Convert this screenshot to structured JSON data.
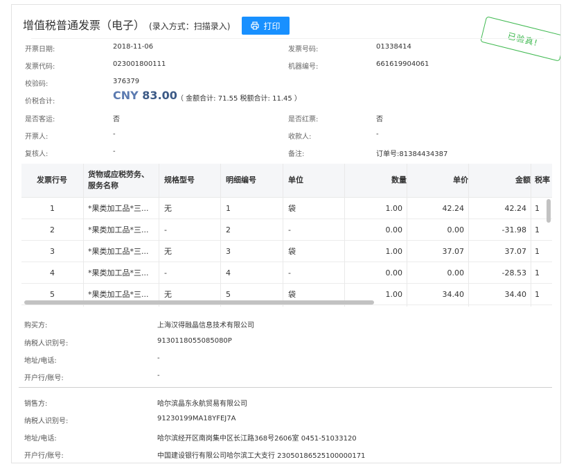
{
  "header": {
    "title": "增值税普通发票（电子）",
    "subtitle": "(录入方式：扫描录入)",
    "print_label": "打印",
    "stamp": "已验真!"
  },
  "info": {
    "issue_date_label": "开票日期:",
    "issue_date": "2018-11-06",
    "invoice_no_label": "发票号码:",
    "invoice_no": "01338414",
    "invoice_code_label": "发票代码:",
    "invoice_code": "023001800111",
    "machine_no_label": "机器编号:",
    "machine_no": "661619904061",
    "check_code_label": "校验码:",
    "check_code": "376379",
    "total_label": "价税合计:",
    "currency": "CNY",
    "total": "83.00",
    "total_detail": "（ 金额合计: 71.55  税额合计: 11.45 ）",
    "passenger_label": "是否客运:",
    "passenger": "否",
    "red_label": "是否红票:",
    "red": "否",
    "issuer_label": "开票人:",
    "issuer": "-",
    "payee_label": "收款人:",
    "payee": "-",
    "reviewer_label": "复核人:",
    "reviewer": "-",
    "remark_label": "备注:",
    "remark": "订单号:81384434387"
  },
  "table": {
    "headers": {
      "row_no": "发票行号",
      "goods_line1": "货物或应税劳务、",
      "goods_line2": "服务名称",
      "spec": "规格型号",
      "detail_no": "明细编号",
      "unit": "单位",
      "qty": "数量",
      "price": "单价",
      "amount": "金额",
      "tax_rate": "税率"
    },
    "rows": [
      {
        "no": "1",
        "name": "*果类加工品*三...",
        "spec": "无",
        "detail": "1",
        "unit": "袋",
        "qty": "1.00",
        "price": "42.24",
        "amount": "42.24",
        "rate": "1"
      },
      {
        "no": "2",
        "name": "*果类加工品*三...",
        "spec": "-",
        "detail": "2",
        "unit": "-",
        "qty": "0.00",
        "price": "0.00",
        "amount": "-31.98",
        "rate": "1"
      },
      {
        "no": "3",
        "name": "*果类加工品*三...",
        "spec": "无",
        "detail": "3",
        "unit": "袋",
        "qty": "1.00",
        "price": "37.07",
        "amount": "37.07",
        "rate": "1"
      },
      {
        "no": "4",
        "name": "*果类加工品*三...",
        "spec": "-",
        "detail": "4",
        "unit": "-",
        "qty": "0.00",
        "price": "0.00",
        "amount": "-28.53",
        "rate": "1"
      },
      {
        "no": "5",
        "name": "*果类加工品*三...",
        "spec": "无",
        "detail": "5",
        "unit": "袋",
        "qty": "1.00",
        "price": "34.40",
        "amount": "34.40",
        "rate": "1"
      }
    ]
  },
  "buyer": {
    "name_label": "购买方:",
    "name": "上海汉得融晶信息技术有限公司",
    "tax_id_label": "纳税人识别号:",
    "tax_id": "9130118055085080P",
    "addr_label": "地址/电话:",
    "addr": "-",
    "bank_label": "开户行/账号:",
    "bank": "-"
  },
  "seller": {
    "name_label": "销售方:",
    "name": "哈尔滨晶东永航贸易有限公司",
    "tax_id_label": "纳税人识别号:",
    "tax_id": "91230199MA18YFEJ7A",
    "addr_label": "地址/电话:",
    "addr": "哈尔滨经开区南岗集中区长江路368号2606室 0451-51033120",
    "bank_label": "开户行/账号:",
    "bank": "中国建设银行有限公司哈尔滨工大支行 23050186525100000171"
  },
  "colors": {
    "primary": "#1890ff",
    "stamp": "#3fb950",
    "amount": "#3c5a86"
  }
}
